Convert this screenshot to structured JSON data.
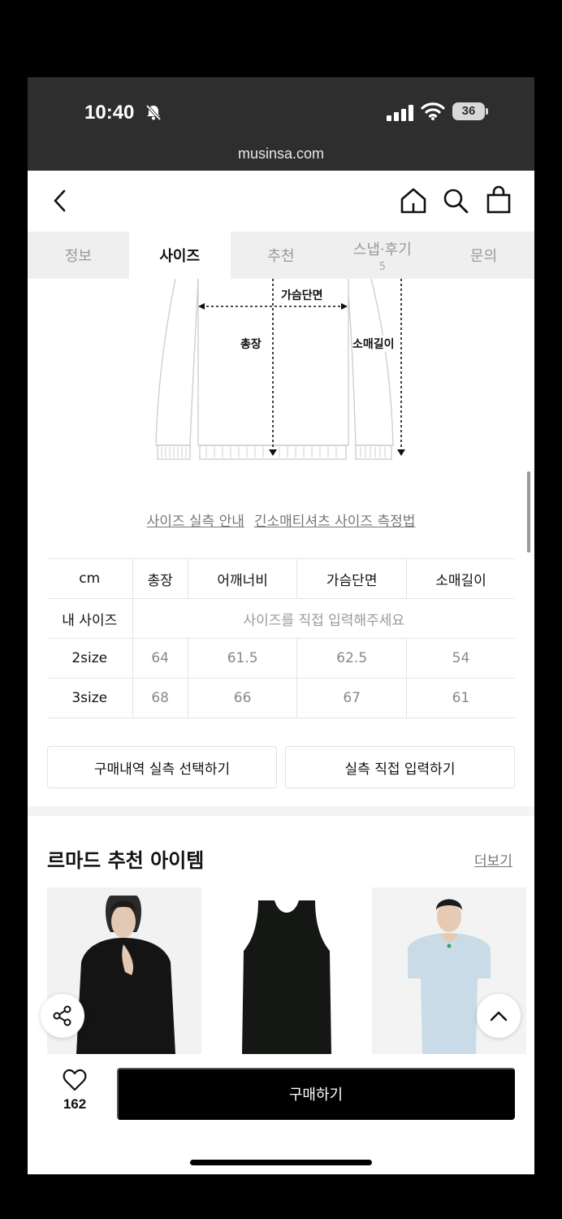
{
  "status_bar": {
    "time": "10:40",
    "battery": "36"
  },
  "browser": {
    "url": "musinsa.com"
  },
  "tabs": [
    {
      "label": "정보",
      "count": ""
    },
    {
      "label": "사이즈",
      "count": ""
    },
    {
      "label": "추천",
      "count": ""
    },
    {
      "label": "스냅·후기",
      "count": "5"
    },
    {
      "label": "문의",
      "count": ""
    }
  ],
  "illustration": {
    "labels": {
      "chest": "가슴단면",
      "length": "총장",
      "sleeve": "소매길이"
    }
  },
  "guide_links": {
    "measure_guide": "사이즈 실측 안내",
    "method": "긴소매티셔츠 사이즈 측정법"
  },
  "size_table": {
    "headers": [
      "cm",
      "총장",
      "어깨너비",
      "가슴단면",
      "소매길이"
    ],
    "my_size": {
      "label": "내 사이즈",
      "placeholder": "사이즈를 직접 입력해주세요"
    },
    "rows": [
      {
        "size": "2size",
        "values": [
          "64",
          "61.5",
          "62.5",
          "54"
        ]
      },
      {
        "size": "3size",
        "values": [
          "68",
          "66",
          "67",
          "61"
        ]
      }
    ]
  },
  "buttons": {
    "select_history": "구매내역 실측 선택하기",
    "direct_input": "실측 직접 입력하기"
  },
  "recommend": {
    "title": "르마드 추천 아이템",
    "more": "더보기"
  },
  "bottom": {
    "like_count": "162",
    "buy_label": "구매하기"
  },
  "colors": {
    "status_bar_bg": "#2e2e2e",
    "buy_button_bg": "#000000",
    "tab_bar_bg": "#efefef"
  }
}
